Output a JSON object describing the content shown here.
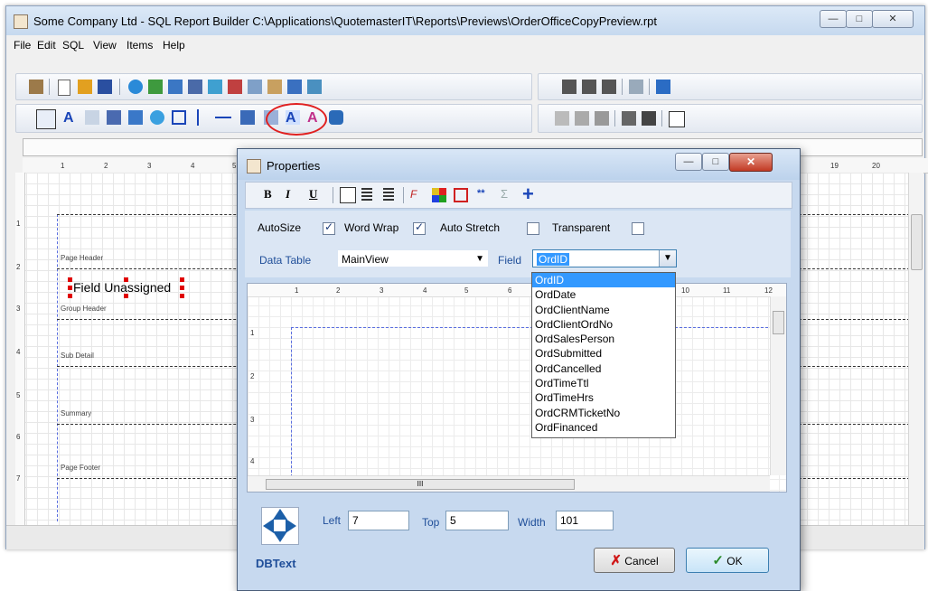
{
  "main_window": {
    "title": "Some Company Ltd - SQL Report Builder  C:\\Applications\\QuotemasterIT\\Reports\\Previews\\OrderOfficeCopyPreview.rpt",
    "controls": {
      "minimize": "—",
      "maximize": "□",
      "close": "✕"
    }
  },
  "menu": [
    "File",
    "Edit",
    "SQL",
    "View",
    "Items",
    "Help"
  ],
  "ruler_numbers": [
    "1",
    "2",
    "3",
    "4",
    "5"
  ],
  "ruler_numbers_right": [
    "19",
    "20"
  ],
  "left_ruler": [
    "1",
    "2",
    "3",
    "4",
    "5",
    "6",
    "7"
  ],
  "bands": {
    "page_header": "Page Header",
    "group_header": "Group Header",
    "sub_detail": "Sub Detail",
    "summary": "Summary",
    "page_footer": "Page Footer"
  },
  "selected_field_text": "Field Unassigned",
  "properties": {
    "title": "Properties",
    "format_buttons": {
      "bold": "B",
      "italic": "I",
      "underline": "U",
      "sum": "Σ",
      "plus": "+"
    },
    "options": {
      "autosize_label": "AutoSize",
      "autosize": true,
      "wordwrap_label": "Word Wrap",
      "wordwrap": true,
      "autostretch_label": "Auto Stretch",
      "autostretch": false,
      "transparent_label": "Transparent",
      "transparent": false
    },
    "data_table_label": "Data Table",
    "data_table_value": "MainView",
    "field_label": "Field",
    "field_value": "OrdID",
    "field_options": [
      "OrdID",
      "OrdDate",
      "OrdClientName",
      "OrdClientOrdNo",
      "OrdSalesPerson",
      "OrdSubmitted",
      "OrdCancelled",
      "OrdTimeTtl",
      "OrdTimeHrs",
      "OrdCRMTicketNo",
      "OrdFinanced"
    ],
    "preview_ruler": [
      "1",
      "2",
      "3",
      "4",
      "5",
      "6",
      "10",
      "11",
      "12"
    ],
    "preview_left_ruler": [
      "1",
      "2",
      "3",
      "4"
    ],
    "left_label": "Left",
    "left_value": "7",
    "top_label": "Top",
    "top_value": "5",
    "width_label": "Width",
    "width_value": "101",
    "component_name": "DBText",
    "cancel_label": "Cancel",
    "ok_label": "OK",
    "scroll_glyph": "III"
  },
  "colors": {
    "accent": "#3399ff",
    "title_bar": "#c6d9ef",
    "highlight_circle": "#e02020",
    "label_blue": "#1f4e99"
  }
}
